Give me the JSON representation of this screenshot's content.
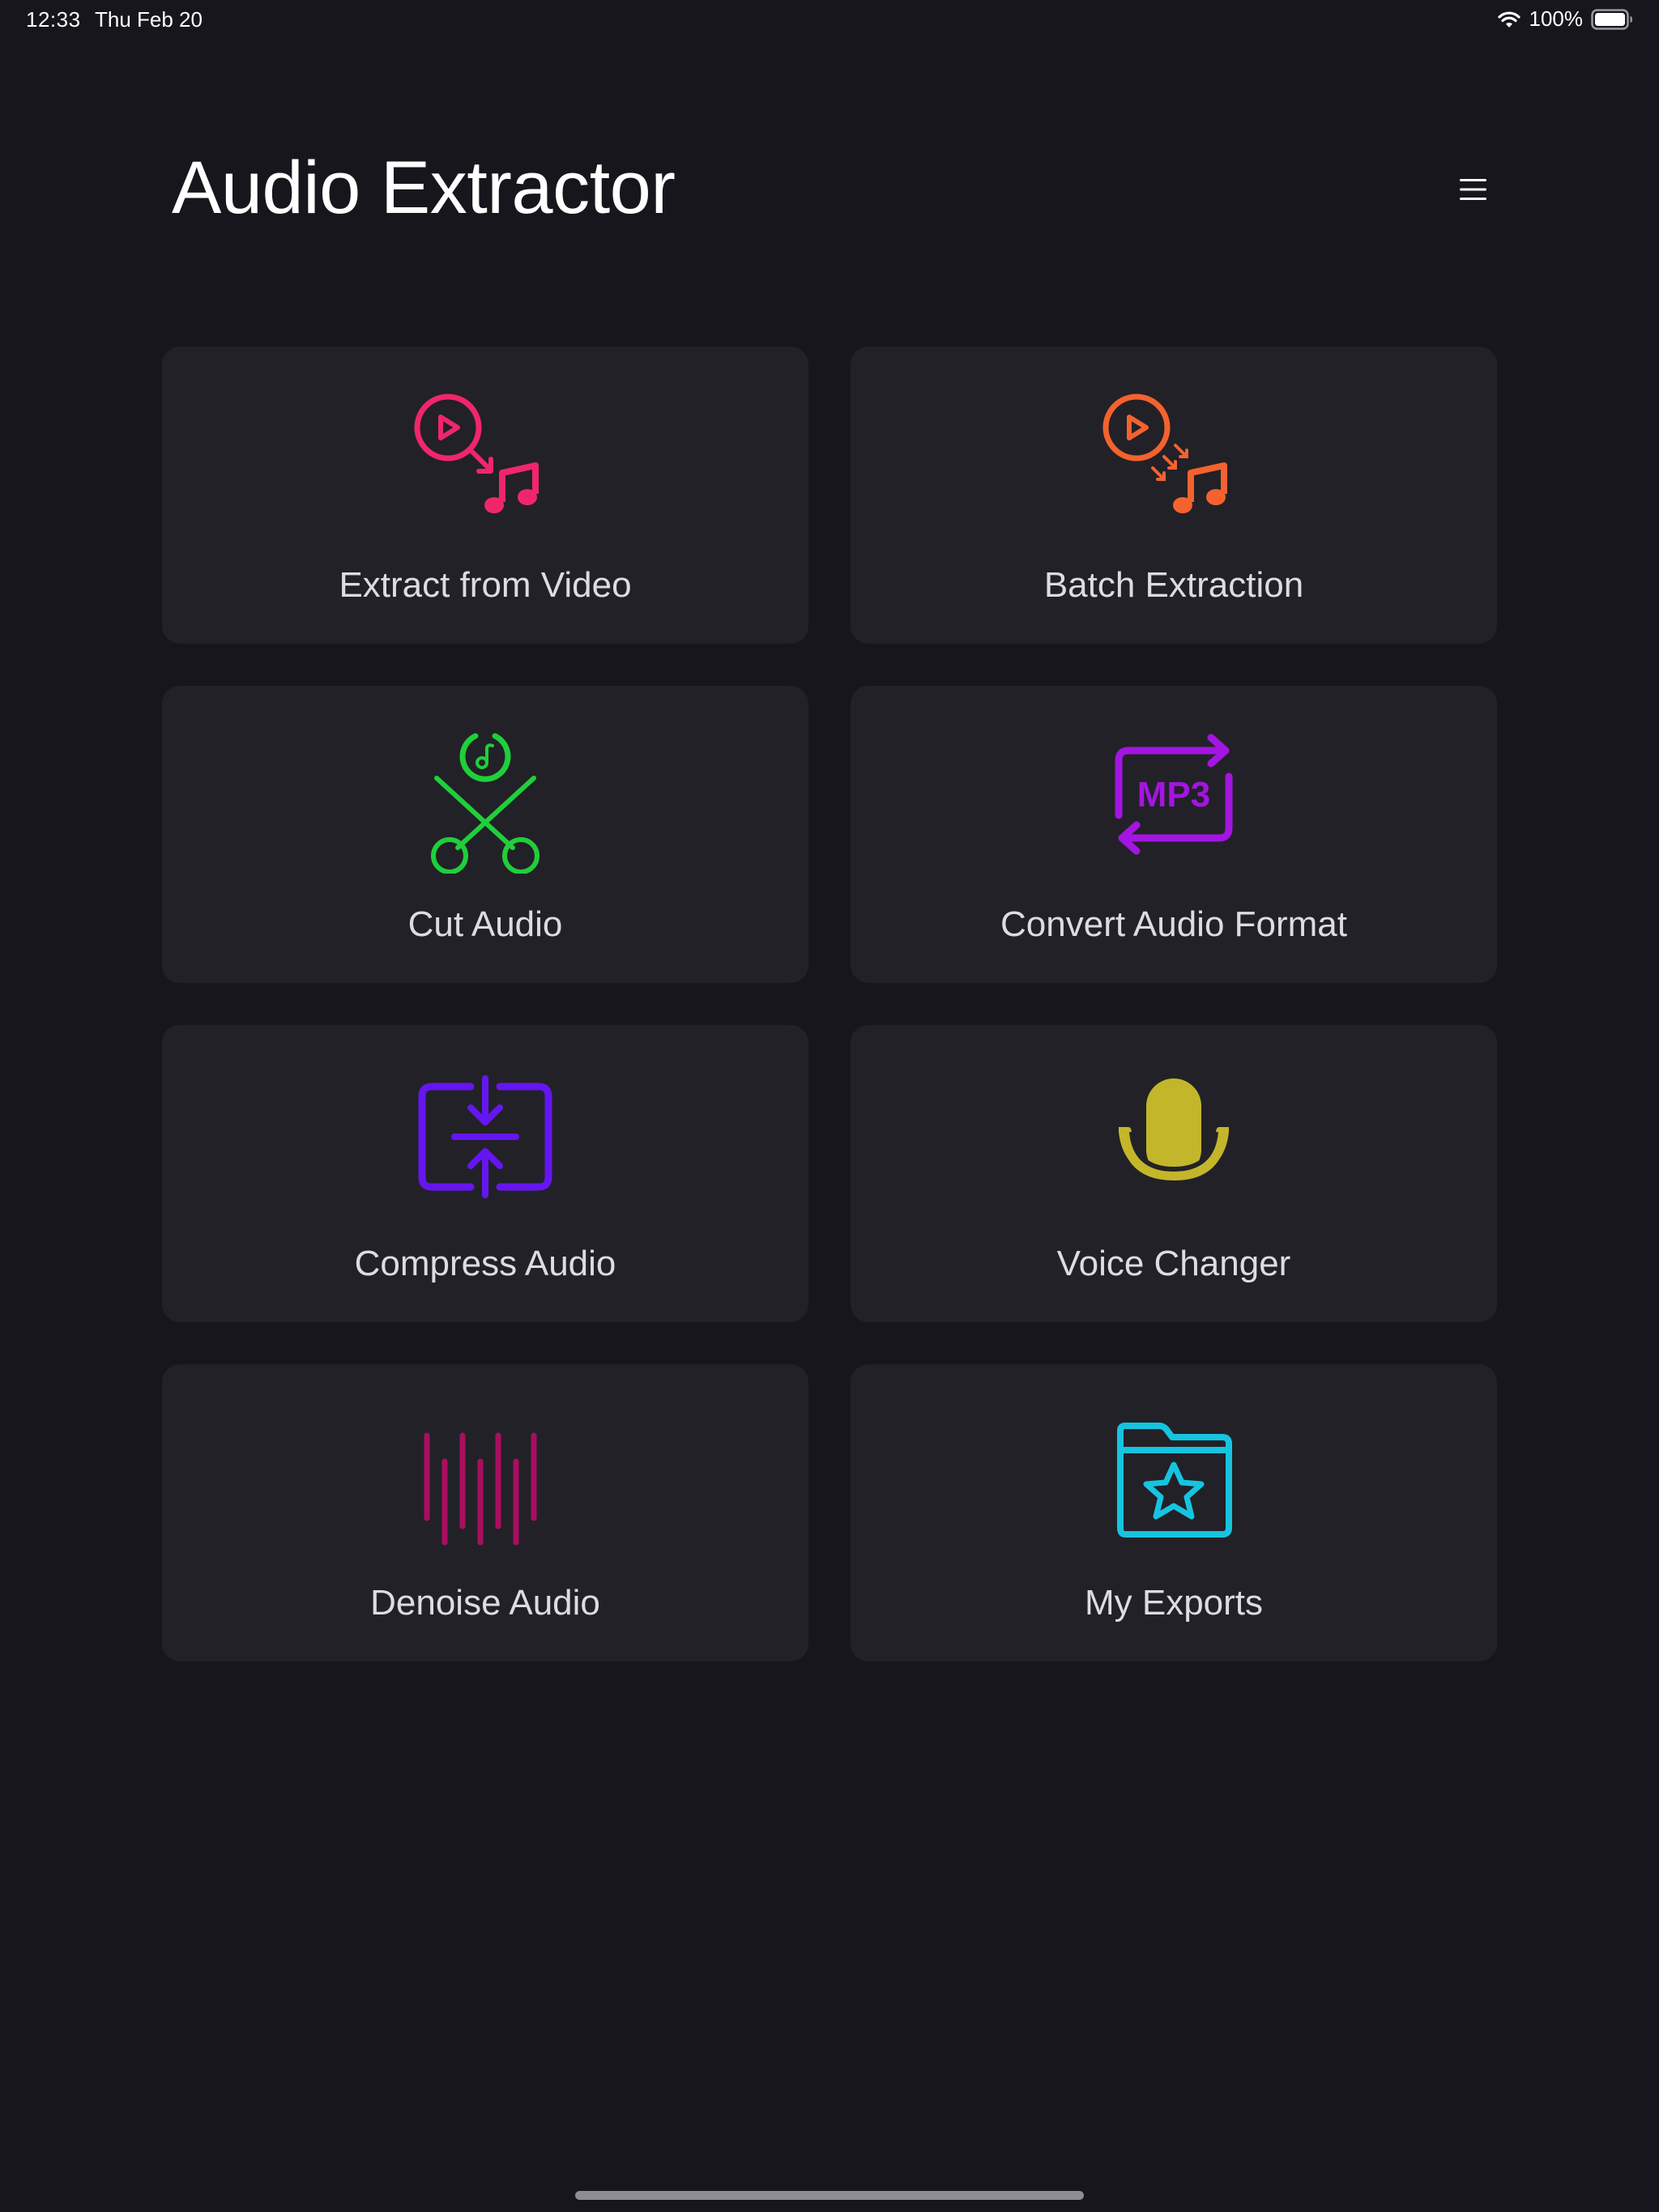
{
  "status_bar": {
    "time": "12:33",
    "date": "Thu Feb 20",
    "battery": "100%"
  },
  "header": {
    "title": "Audio Extractor",
    "menu_icon": "hamburger-menu-icon"
  },
  "tools": [
    {
      "label": "Extract from Video",
      "icon": "video-to-music-icon",
      "color": "#f0266b"
    },
    {
      "label": "Batch Extraction",
      "icon": "batch-video-to-music-icon",
      "color": "#f4622e"
    },
    {
      "label": "Cut Audio",
      "icon": "scissors-music-icon",
      "color": "#1fcf3a"
    },
    {
      "label": "Convert Audio Format",
      "icon": "mp3-convert-icon",
      "color": "#a315e0"
    },
    {
      "label": "Compress Audio",
      "icon": "compress-icon",
      "color": "#6516f0"
    },
    {
      "label": "Voice Changer",
      "icon": "microphone-icon",
      "color": "#c4b62a"
    },
    {
      "label": "Denoise Audio",
      "icon": "waveform-icon",
      "color": "#a80f5f"
    },
    {
      "label": "My Exports",
      "icon": "star-folder-icon",
      "color": "#16c4e0"
    }
  ],
  "icon_texts": {
    "mp3": "MP3"
  },
  "colors": {
    "background": "#17161c",
    "card": "#222127",
    "label": "#dcdce2"
  }
}
